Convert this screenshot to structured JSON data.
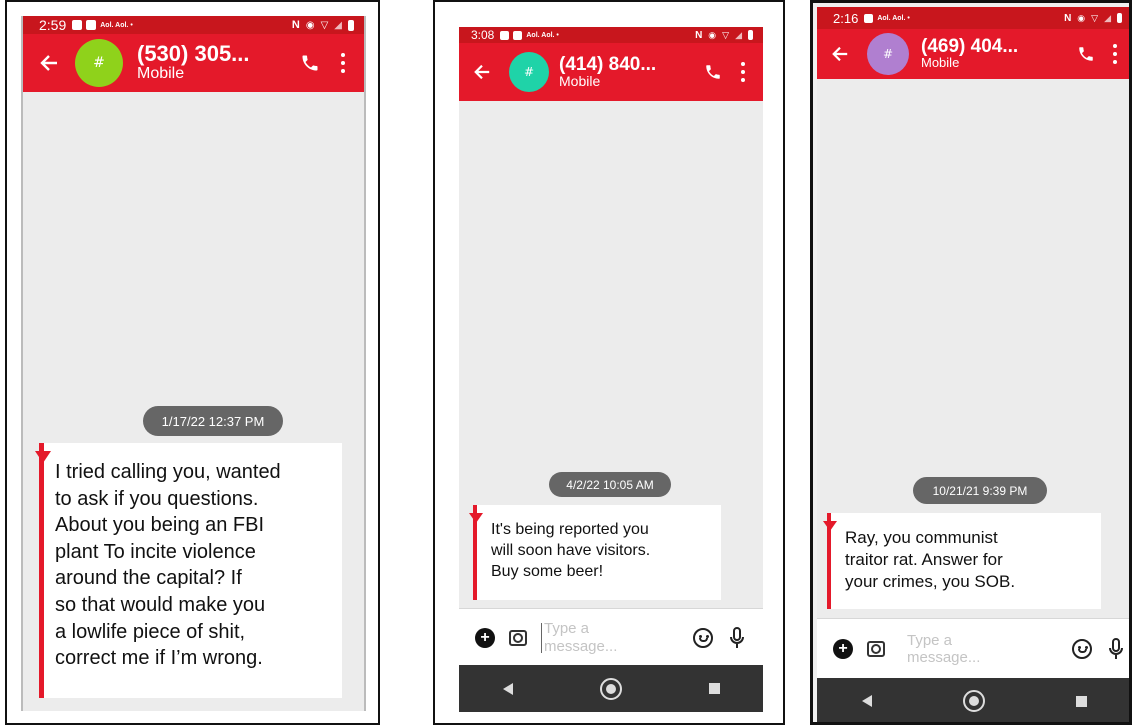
{
  "screens": [
    {
      "status_time": "2:59",
      "status_app": "Aol. Aol. •",
      "contact_title": "(530) 305...",
      "contact_sub": "Mobile",
      "avatar_glyph": "#",
      "avatar_color": "#8fd21b",
      "date_pill": "1/17/22 12:37 PM",
      "message": "I tried calling you, wanted\nto ask if you questions.\nAbout you being an FBI\nplant To incite violence\naround the capital? If\nso that would make you\na lowlife piece of shit,\ncorrect me if I’m wrong."
    },
    {
      "status_time": "3:08",
      "status_app": "Aol. Aol. •",
      "contact_title": "(414) 840...",
      "contact_sub": "Mobile",
      "avatar_glyph": "#",
      "avatar_color": "#1fd3a8",
      "date_pill": "4/2/22 10:05 AM",
      "message": "It's being reported you\nwill soon have visitors.\nBuy some beer!",
      "composer_placeholder": "Type a\nmessage..."
    },
    {
      "status_time": "2:16",
      "status_app": "Aol. Aol. •",
      "contact_title": "(469) 404...",
      "contact_sub": "Mobile",
      "avatar_glyph": "#",
      "avatar_color": "#b07fd0",
      "date_pill": "10/21/21 9:39 PM",
      "message": "Ray, you communist\ntraitor rat. Answer for\nyour crimes, you SOB.",
      "composer_placeholder": "Type a\nmessage..."
    }
  ],
  "icons": [
    "back-arrow-icon",
    "phone-icon",
    "more-vert-icon",
    "add-circle-icon",
    "camera-icon",
    "emoji-icon",
    "mic-icon",
    "nav-back-icon",
    "nav-home-icon",
    "nav-recents-icon",
    "nfc-icon",
    "wifi-icon",
    "signal-icon",
    "battery-icon"
  ],
  "colors": {
    "appbar": "#e4192a",
    "statusbar": "#c8161d",
    "chat_bg": "#ececec",
    "pill": "#666666"
  }
}
